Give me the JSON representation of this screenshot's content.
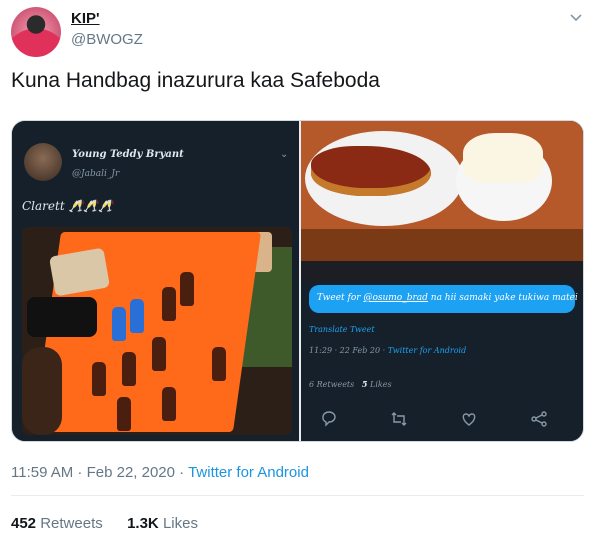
{
  "tweet": {
    "display_name": "KIP'",
    "handle": "@BWOGZ",
    "text": "Kuna Handbag inazurura kaa Safeboda",
    "timestamp": "11:59 AM · Feb 22, 2020 · ",
    "source": "Twitter for Android",
    "retweets_count": "452",
    "retweets_label": "Retweets",
    "likes_count": "1.3K",
    "likes_label": "Likes",
    "icons": [
      "chevron-down-icon"
    ]
  },
  "media": {
    "left": {
      "name": "Young Teddy Bryant",
      "handle": "@Jabali_Jr",
      "text": "Clarett 🥂🥂🥂"
    },
    "right": {
      "reply_prefix": "Tweet for ",
      "reply_mention": "@osumo_brad",
      "reply_rest": " na hii samaki yake tukiwa matei",
      "translate": "Translate Tweet",
      "time": "11:29 · 22 Feb 20 · ",
      "source": "Twitter for Android",
      "retweets": "6 Retweets",
      "likes_count": "5",
      "likes_label": "Likes",
      "actions": [
        "reply-icon",
        "retweet-icon",
        "heart-icon",
        "share-icon"
      ]
    }
  },
  "colors": {
    "accent": "#1da1f2",
    "link": "#1b95e0",
    "text": "#14171a",
    "muted": "#657786"
  }
}
